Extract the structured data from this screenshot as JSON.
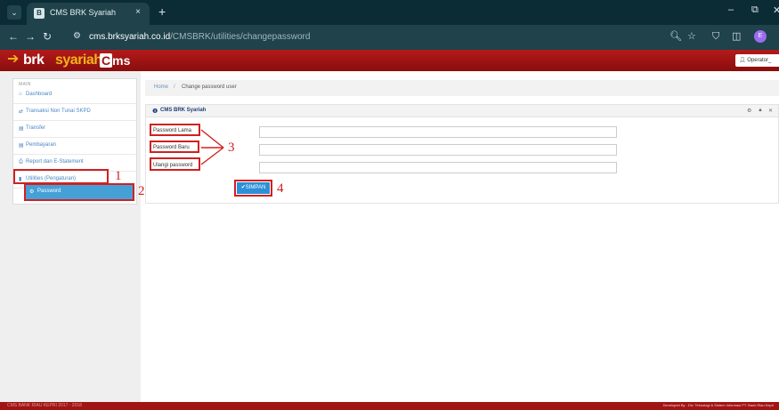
{
  "browser": {
    "tab_title": "CMS BRK Syariah",
    "tab_close": "×",
    "new_tab": "+",
    "url_host": "cms.brksyariah.co.id",
    "url_path": "/CMSBRK/utilities/changepassword",
    "profile_initial": "E"
  },
  "header": {
    "logo_brk": "brk",
    "logo_syariah": "syariah",
    "logo_cms_c": "C",
    "logo_cms_ms": "ms",
    "user_label": "Operator_"
  },
  "sidebar": {
    "heading": "MAIN",
    "items": [
      {
        "icon": "⌂",
        "label": "Dashboard"
      },
      {
        "icon": "⇄",
        "label": "Transaksi Non Tunai SKPD"
      },
      {
        "icon": "▤",
        "label": "Transfer"
      },
      {
        "icon": "▤",
        "label": "Pembayaran"
      },
      {
        "icon": "⎙",
        "label": "Report dan E-Statement"
      },
      {
        "icon": "▮",
        "label": "Utilities (Pengaturan)"
      }
    ],
    "sub_item": {
      "icon": "⚙",
      "label": "Password"
    }
  },
  "breadcrumb": {
    "home": "Home",
    "separator": "/",
    "current": "Change password user"
  },
  "panel": {
    "title": "CMS BRK Syariah",
    "fields": [
      {
        "label": "Password Lama",
        "value": ""
      },
      {
        "label": "Password Baru",
        "value": ""
      },
      {
        "label": "Ulangi password",
        "value": ""
      }
    ],
    "save_label": "✔SIMPAN"
  },
  "annotations": {
    "n1": "1",
    "n2": "2",
    "n3": "3",
    "n4": "4"
  },
  "footer": {
    "left": "CMS BANK RIAU KEPRI 2017 - 2018",
    "right": "Developed By : Div. Teknologi & Sistem Informasi PT. Bank Riau Kepri"
  },
  "colors": {
    "chrome_dark": "#0c2c35",
    "chrome_toolbar": "#1f424b",
    "brand_red": "#a11414",
    "brand_gold": "#f2b31b",
    "link_blue": "#4a86c5",
    "active_blue": "#46a0d8",
    "annotation_red": "#d02020"
  }
}
